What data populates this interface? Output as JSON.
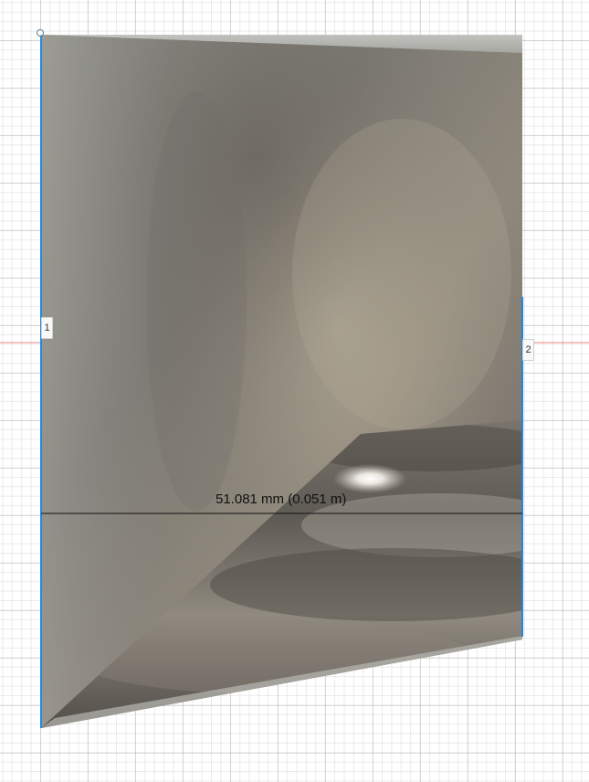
{
  "app": {
    "name": "CAD Viewport"
  },
  "viewport": {
    "grid": true,
    "background_color": "#ffffff",
    "grid_color": "#d0d0d0",
    "axis_color": "#e53935",
    "selection_color": "#1e88e5"
  },
  "measurement": {
    "label": "51.081 mm (0.051 m)"
  },
  "edges": [
    {
      "tag": "1"
    },
    {
      "tag": "2"
    }
  ]
}
